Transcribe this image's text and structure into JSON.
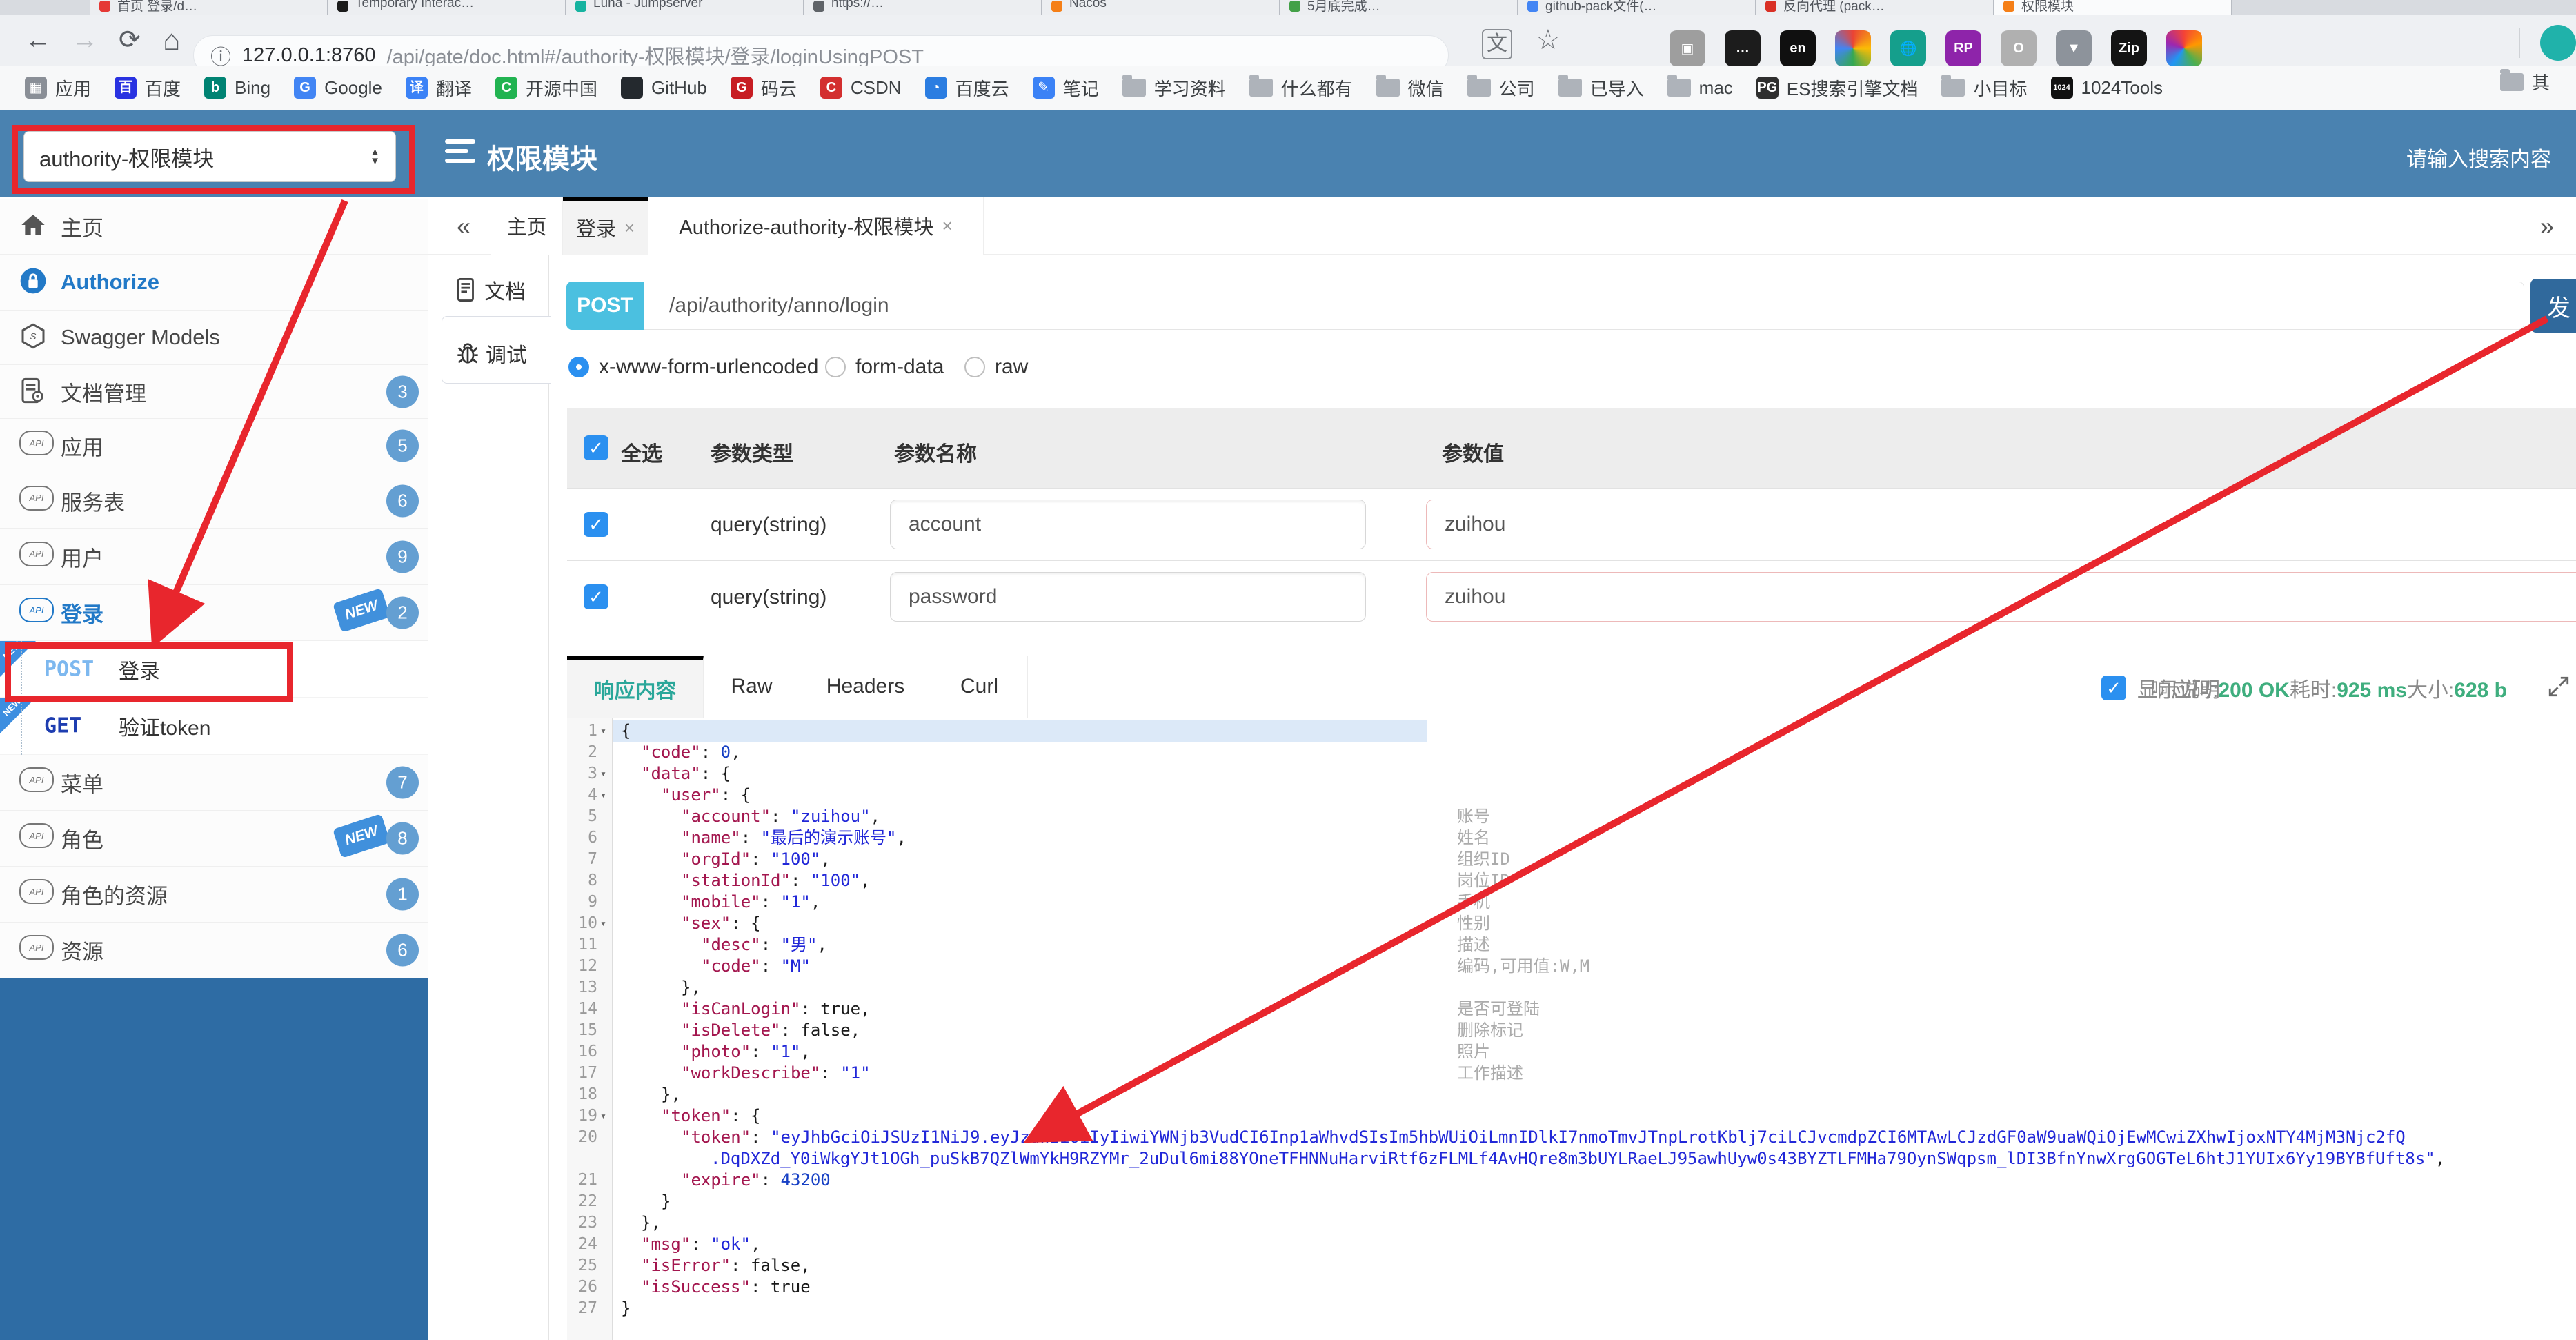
{
  "browser": {
    "tabs": [
      {
        "title": "首页 登录/d…",
        "color": "#e53935",
        "active": false
      },
      {
        "title": "Temporary Interac…",
        "color": "#1b1b1b",
        "active": false
      },
      {
        "title": "Luna - Jumpserver",
        "color": "#16b3a0",
        "active": false
      },
      {
        "title": "https://…",
        "color": "#5f6368",
        "active": false
      },
      {
        "title": "Nacos",
        "color": "#f57f17",
        "active": false
      },
      {
        "title": "5月底完成…",
        "color": "#43a047",
        "active": false
      },
      {
        "title": "github-pack文件(…",
        "color": "#4285f4",
        "active": false
      },
      {
        "title": "反向代理 (pack…",
        "color": "#d93025",
        "active": false
      },
      {
        "title": "权限模块",
        "color": "#f57f17",
        "active": true
      }
    ],
    "url_host": "127.0.0.1:8760",
    "url_path": "/api/gate/doc.html#/authority-权限模块/登录/loginUsingPOST",
    "bookmarks": [
      {
        "label": "应用",
        "glyph": "▦",
        "color": "#8a8f97",
        "type": "site"
      },
      {
        "label": "百度",
        "glyph": "百",
        "color": "#2932e1",
        "type": "site"
      },
      {
        "label": "Bing",
        "glyph": "b",
        "color": "#008373",
        "type": "site"
      },
      {
        "label": "Google",
        "glyph": "G",
        "color": "#4285f4",
        "type": "site"
      },
      {
        "label": "翻译",
        "glyph": "译",
        "color": "#3b82f6",
        "type": "site"
      },
      {
        "label": "开源中国",
        "glyph": "C",
        "color": "#21b351",
        "type": "site"
      },
      {
        "label": "GitHub",
        "glyph": "",
        "color": "#24292e",
        "type": "site"
      },
      {
        "label": "码云",
        "glyph": "G",
        "color": "#c71d23",
        "type": "site"
      },
      {
        "label": "CSDN",
        "glyph": "C",
        "color": "#d32f2f",
        "type": "site"
      },
      {
        "label": "百度云",
        "glyph": "◔",
        "color": "#2b7de1",
        "type": "site"
      },
      {
        "label": "笔记",
        "glyph": "✎",
        "color": "#3b82f6",
        "type": "site"
      },
      {
        "label": "学习资料",
        "type": "folder"
      },
      {
        "label": "什么都有",
        "type": "folder"
      },
      {
        "label": "微信",
        "type": "folder"
      },
      {
        "label": "公司",
        "type": "folder"
      },
      {
        "label": "已导入",
        "type": "folder"
      },
      {
        "label": "mac",
        "type": "folder"
      },
      {
        "label": "ES搜索引擎文档",
        "glyph": "PG",
        "color": "#2f2f2f",
        "type": "site"
      },
      {
        "label": "小目标",
        "type": "folder"
      },
      {
        "label": "1024Tools",
        "glyph": "1024",
        "color": "#111111",
        "type": "site"
      }
    ],
    "bookmarks_overflow": "其"
  },
  "header": {
    "group_select": "authority-权限模块",
    "title": "权限模块",
    "search_placeholder": "请输入搜索内容"
  },
  "sidebar": {
    "items": [
      {
        "label": "主页",
        "icon": "home"
      },
      {
        "label": "Authorize",
        "icon": "lock",
        "blue": true
      },
      {
        "label": "Swagger Models",
        "icon": "hexagon"
      },
      {
        "label": "文档管理",
        "icon": "docgear",
        "badge": "3"
      },
      {
        "label": "应用",
        "icon": "cloud",
        "badge": "5"
      },
      {
        "label": "服务表",
        "icon": "cloud",
        "badge": "6"
      },
      {
        "label": "用户",
        "icon": "cloud",
        "badge": "9"
      },
      {
        "label": "登录",
        "icon": "cloud",
        "badge": "2",
        "is_new": true,
        "blue": true,
        "expanded": true,
        "children": [
          {
            "method": "POST",
            "label": "登录",
            "method_color": "#7db8ef",
            "is_new": true
          },
          {
            "method": "GET",
            "label": "验证token",
            "method_color": "#1e3db0",
            "is_new": true
          }
        ]
      },
      {
        "label": "菜单",
        "icon": "cloud",
        "badge": "7"
      },
      {
        "label": "角色",
        "icon": "cloud",
        "badge": "8",
        "is_new": true
      },
      {
        "label": "角色的资源",
        "icon": "cloud",
        "badge": "1"
      },
      {
        "label": "资源",
        "icon": "cloud",
        "badge": "6"
      }
    ]
  },
  "content_tabs": {
    "collapse": "«",
    "expand": "»",
    "tabs": [
      {
        "label": "主页",
        "closable": false,
        "active": false
      },
      {
        "label": "登录",
        "closable": true,
        "active": true
      },
      {
        "label": "Authorize-authority-权限模块",
        "closable": true,
        "active": false
      }
    ],
    "close_glyph": "×"
  },
  "doc_tabs": {
    "doc_label": "文档",
    "debug_label": "调试"
  },
  "endpoint": {
    "method": "POST",
    "path": "/api/authority/anno/login",
    "send_label": "发"
  },
  "body_types": [
    {
      "label": "x-www-form-urlencoded",
      "selected": true
    },
    {
      "label": "form-data",
      "selected": false
    },
    {
      "label": "raw",
      "selected": false
    }
  ],
  "param_table": {
    "select_all": "全选",
    "col_type": "参数类型",
    "col_name": "参数名称",
    "col_value": "参数值",
    "rows": [
      {
        "checked": true,
        "type": "query(string)",
        "name": "account",
        "value": "zuihou"
      },
      {
        "checked": true,
        "type": "query(string)",
        "name": "password",
        "value": "zuihou"
      }
    ]
  },
  "response": {
    "tabs": [
      {
        "label": "响应内容",
        "active": true
      },
      {
        "label": "Raw",
        "active": false
      },
      {
        "label": "Headers",
        "active": false
      },
      {
        "label": "Curl",
        "active": false
      }
    ],
    "show_desc_label": "显示说明",
    "show_desc_checked": true,
    "status_label": "响应码:",
    "status_value": "200 OK",
    "time_label": "耗时:",
    "time_value": "925 ms",
    "size_label": "大小:",
    "size_value": "628 b"
  },
  "code": {
    "lines": [
      {
        "n": 1,
        "ind": 0,
        "fold": true,
        "active": true,
        "seg": [
          [
            "cp",
            "{"
          ]
        ]
      },
      {
        "n": 2,
        "ind": 1,
        "seg": [
          [
            "ck",
            "\"code\""
          ],
          [
            "cp",
            ": "
          ],
          [
            "cn",
            "0"
          ],
          [
            "cp",
            ","
          ]
        ]
      },
      {
        "n": 3,
        "ind": 1,
        "fold": true,
        "seg": [
          [
            "ck",
            "\"data\""
          ],
          [
            "cp",
            ": {"
          ]
        ]
      },
      {
        "n": 4,
        "ind": 2,
        "fold": true,
        "seg": [
          [
            "ck",
            "\"user\""
          ],
          [
            "cp",
            ": {"
          ]
        ]
      },
      {
        "n": 5,
        "ind": 3,
        "seg": [
          [
            "ck",
            "\"account\""
          ],
          [
            "cp",
            ": "
          ],
          [
            "cs",
            "\"zuihou\""
          ],
          [
            "cp",
            ","
          ]
        ],
        "note": "账号"
      },
      {
        "n": 6,
        "ind": 3,
        "seg": [
          [
            "ck",
            "\"name\""
          ],
          [
            "cp",
            ": "
          ],
          [
            "cs",
            "\"最后的演示账号\""
          ],
          [
            "cp",
            ","
          ]
        ],
        "note": "姓名"
      },
      {
        "n": 7,
        "ind": 3,
        "seg": [
          [
            "ck",
            "\"orgId\""
          ],
          [
            "cp",
            ": "
          ],
          [
            "cs",
            "\"100\""
          ],
          [
            "cp",
            ","
          ]
        ],
        "note": "组织ID"
      },
      {
        "n": 8,
        "ind": 3,
        "seg": [
          [
            "ck",
            "\"stationId\""
          ],
          [
            "cp",
            ": "
          ],
          [
            "cs",
            "\"100\""
          ],
          [
            "cp",
            ","
          ]
        ],
        "note": "岗位ID"
      },
      {
        "n": 9,
        "ind": 3,
        "seg": [
          [
            "ck",
            "\"mobile\""
          ],
          [
            "cp",
            ": "
          ],
          [
            "cs",
            "\"1\""
          ],
          [
            "cp",
            ","
          ]
        ],
        "note": "手机"
      },
      {
        "n": 10,
        "ind": 3,
        "fold": true,
        "seg": [
          [
            "ck",
            "\"sex\""
          ],
          [
            "cp",
            ": {"
          ]
        ],
        "note": "性别"
      },
      {
        "n": 11,
        "ind": 4,
        "seg": [
          [
            "ck",
            "\"desc\""
          ],
          [
            "cp",
            ": "
          ],
          [
            "cs",
            "\"男\""
          ],
          [
            "cp",
            ","
          ]
        ],
        "note": "描述"
      },
      {
        "n": 12,
        "ind": 4,
        "seg": [
          [
            "ck",
            "\"code\""
          ],
          [
            "cp",
            ": "
          ],
          [
            "cs",
            "\"M\""
          ]
        ],
        "note": "编码,可用值:W,M"
      },
      {
        "n": 13,
        "ind": 3,
        "seg": [
          [
            "cp",
            "},"
          ]
        ]
      },
      {
        "n": 14,
        "ind": 3,
        "seg": [
          [
            "ck",
            "\"isCanLogin\""
          ],
          [
            "cp",
            ": "
          ],
          [
            "cb",
            "true"
          ],
          [
            "cp",
            ","
          ]
        ],
        "note": "是否可登陆"
      },
      {
        "n": 15,
        "ind": 3,
        "seg": [
          [
            "ck",
            "\"isDelete\""
          ],
          [
            "cp",
            ": "
          ],
          [
            "cb",
            "false"
          ],
          [
            "cp",
            ","
          ]
        ],
        "note": "删除标记"
      },
      {
        "n": 16,
        "ind": 3,
        "seg": [
          [
            "ck",
            "\"photo\""
          ],
          [
            "cp",
            ": "
          ],
          [
            "cs",
            "\"1\""
          ],
          [
            "cp",
            ","
          ]
        ],
        "note": "照片"
      },
      {
        "n": 17,
        "ind": 3,
        "seg": [
          [
            "ck",
            "\"workDescribe\""
          ],
          [
            "cp",
            ": "
          ],
          [
            "cs",
            "\"1\""
          ]
        ],
        "note": "工作描述"
      },
      {
        "n": 18,
        "ind": 2,
        "seg": [
          [
            "cp",
            "},"
          ]
        ]
      },
      {
        "n": 19,
        "ind": 2,
        "fold": true,
        "seg": [
          [
            "ck",
            "\"token\""
          ],
          [
            "cp",
            ": {"
          ]
        ]
      },
      {
        "n": 20,
        "ind": 3,
        "seg": [
          [
            "ck",
            "\"token\""
          ],
          [
            "cp",
            ": "
          ],
          [
            "cs",
            "\"eyJhbGciOiJSUzI1NiJ9.eyJzdWIiOiIyIiwiYWNjb3VudCI6Inp1aWhvdSIsIm5hbWUiOiLmnIDlkI7nmoTmvJTnpLrotKblj7ciLCJvcmdpZCI6MTAwLCJzdGF0aW9uaWQiOjEwMCwiZXhwIjoxNTY4MjM3Njc2fQ"
          ]
        ],
        "wrap_ind": 4,
        "wrap_seg": [
          [
            "cs",
            ".DqDXZd_Y0iWkgYJt1OGh_puSkB7QZlWmYkH9RZYMr_2uDul6mi88YOneTFHNNuHarviRtf6zFLMLf4AvHQre8m3bUYLRaeLJ95awhUyw0s43BYZTLFMHa79OynSWqpsm_lDI3BfnYnwXrgGOGTeL6htJ1YUIx6Yy19BYBfUft8s\""
          ],
          [
            "cp",
            ","
          ]
        ]
      },
      {
        "n": 21,
        "ind": 3,
        "seg": [
          [
            "ck",
            "\"expire\""
          ],
          [
            "cp",
            ": "
          ],
          [
            "cn",
            "43200"
          ]
        ]
      },
      {
        "n": 22,
        "ind": 2,
        "seg": [
          [
            "cp",
            "}"
          ]
        ]
      },
      {
        "n": 23,
        "ind": 1,
        "seg": [
          [
            "cp",
            "},"
          ]
        ]
      },
      {
        "n": 24,
        "ind": 1,
        "seg": [
          [
            "ck",
            "\"msg\""
          ],
          [
            "cp",
            ": "
          ],
          [
            "cs",
            "\"ok\""
          ],
          [
            "cp",
            ","
          ]
        ]
      },
      {
        "n": 25,
        "ind": 1,
        "seg": [
          [
            "ck",
            "\"isError\""
          ],
          [
            "cp",
            ": "
          ],
          [
            "cb",
            "false"
          ],
          [
            "cp",
            ","
          ]
        ]
      },
      {
        "n": 26,
        "ind": 1,
        "seg": [
          [
            "ck",
            "\"isSuccess\""
          ],
          [
            "cp",
            ": "
          ],
          [
            "cb",
            "true"
          ]
        ]
      },
      {
        "n": 27,
        "ind": 0,
        "seg": [
          [
            "cp",
            "}"
          ]
        ]
      }
    ]
  },
  "annotation_color": "#e8262d"
}
